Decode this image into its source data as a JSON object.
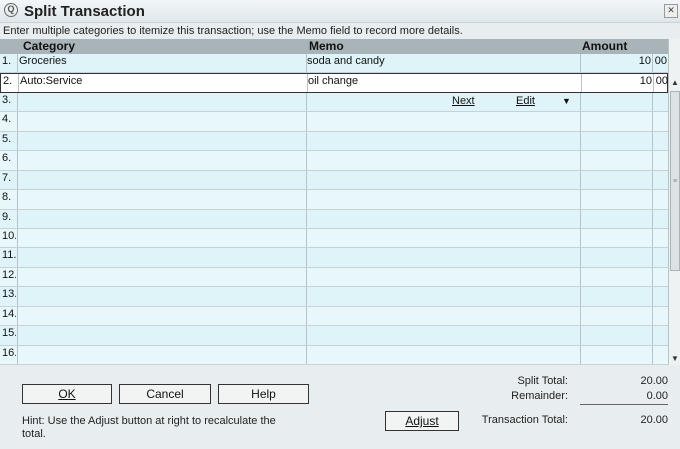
{
  "window": {
    "title": "Split Transaction",
    "close_glyph": "✕"
  },
  "instructions": "Enter multiple categories to itemize this transaction; use the Memo field to record more details.",
  "grid": {
    "headers": {
      "category": "Category",
      "memo": "Memo",
      "amount": "Amount"
    },
    "rows": [
      {
        "num": "1.",
        "category": "Groceries",
        "memo": "soda and candy",
        "amount": "10",
        "cents": "00"
      },
      {
        "num": "2.",
        "category": "Auto:Service",
        "memo": "oil change",
        "amount": "10",
        "cents": "00"
      },
      {
        "num": "3.",
        "category": "",
        "memo": "",
        "amount": "",
        "cents": ""
      },
      {
        "num": "4.",
        "category": "",
        "memo": "",
        "amount": "",
        "cents": ""
      },
      {
        "num": "5.",
        "category": "",
        "memo": "",
        "amount": "",
        "cents": ""
      },
      {
        "num": "6.",
        "category": "",
        "memo": "",
        "amount": "",
        "cents": ""
      },
      {
        "num": "7.",
        "category": "",
        "memo": "",
        "amount": "",
        "cents": ""
      },
      {
        "num": "8.",
        "category": "",
        "memo": "",
        "amount": "",
        "cents": ""
      },
      {
        "num": "9.",
        "category": "",
        "memo": "",
        "amount": "",
        "cents": ""
      },
      {
        "num": "10.",
        "category": "",
        "memo": "",
        "amount": "",
        "cents": ""
      },
      {
        "num": "11.",
        "category": "",
        "memo": "",
        "amount": "",
        "cents": ""
      },
      {
        "num": "12.",
        "category": "",
        "memo": "",
        "amount": "",
        "cents": ""
      },
      {
        "num": "13.",
        "category": "",
        "memo": "",
        "amount": "",
        "cents": ""
      },
      {
        "num": "14.",
        "category": "",
        "memo": "",
        "amount": "",
        "cents": ""
      },
      {
        "num": "15.",
        "category": "",
        "memo": "",
        "amount": "",
        "cents": ""
      },
      {
        "num": "16.",
        "category": "",
        "memo": "",
        "amount": "",
        "cents": ""
      }
    ],
    "row_actions": {
      "next_label": "Next",
      "edit_label": "Edit",
      "edit_glyph": "▼"
    }
  },
  "buttons": {
    "ok": "OK",
    "cancel": "Cancel",
    "help": "Help",
    "adjust": "Adjust"
  },
  "hint": "Hint: Use the Adjust button at right to recalculate the total.",
  "totals": {
    "split_total_label": "Split Total:",
    "split_total": "20.00",
    "remainder_label": "Remainder:",
    "remainder": "0.00",
    "transaction_total_label": "Transaction Total:",
    "transaction_total": "20.00"
  },
  "icons": {
    "title": "quicken-icon",
    "scroll_up": "▲",
    "scroll_down": "▼",
    "thumb_grip": "≡"
  }
}
